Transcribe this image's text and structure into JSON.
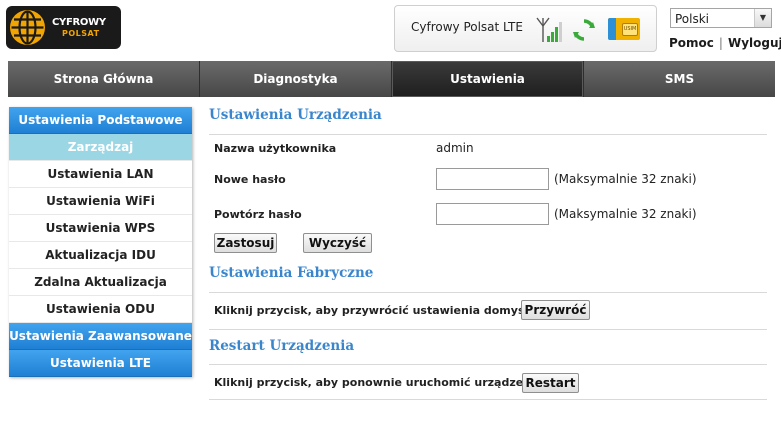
{
  "brand": {
    "line1": "CYFROWY",
    "line2": "POLSAT"
  },
  "status": {
    "operator": "Cyfrowy Polsat",
    "network": "LTE",
    "sim_label": "USIM",
    "signal_level": 0.75
  },
  "language": {
    "selected": "Polski"
  },
  "top_links": {
    "help": "Pomoc",
    "separator": "|",
    "logout": "Wyloguj"
  },
  "nav": {
    "tabs": [
      {
        "label": "Strona Główna"
      },
      {
        "label": "Diagnostyka"
      },
      {
        "label": "Ustawienia"
      },
      {
        "label": "SMS"
      }
    ],
    "active_index": 2
  },
  "sidebar": {
    "items": [
      {
        "label": "Ustawienia Podstawowe"
      },
      {
        "label": "Zarządzaj"
      },
      {
        "label": "Ustawienia LAN"
      },
      {
        "label": "Ustawienia WiFi"
      },
      {
        "label": "Ustawienia WPS"
      },
      {
        "label": "Aktualizacja IDU"
      },
      {
        "label": "Zdalna Aktualizacja"
      },
      {
        "label": "Ustawienia ODU"
      },
      {
        "label": "Ustawienia Zaawansowane"
      },
      {
        "label": "Ustawienia LTE"
      }
    ]
  },
  "device_settings": {
    "title": "Ustawienia Urządzenia",
    "username_label": "Nazwa użytkownika",
    "username_value": "admin",
    "new_password_label": "Nowe hasło",
    "new_password_value": "",
    "new_password_hint": "(Maksymalnie 32 znaki)",
    "repeat_password_label": "Powtórz hasło",
    "repeat_password_value": "",
    "repeat_password_hint": "(Maksymalnie 32 znaki)",
    "apply_button": "Zastosuj",
    "clear_button": "Wyczyść"
  },
  "factory_settings": {
    "title": "Ustawienia Fabryczne",
    "description": "Kliknij przycisk, aby przywrócić ustawienia domyślne",
    "button": "Przywróć"
  },
  "restart": {
    "title": "Restart Urządzenia",
    "description": "Kliknij przycisk, aby ponownie uruchomić urządzenie",
    "button": "Restart"
  },
  "colors": {
    "accent_blue": "#3a86cc",
    "sidebar_head": "#1f7fd3",
    "sidebar_selected": "#9ad6e4",
    "logo_orange": "#f2a500",
    "refresh_green": "#3aab3a",
    "nav_dark": "#2a2a2a"
  }
}
